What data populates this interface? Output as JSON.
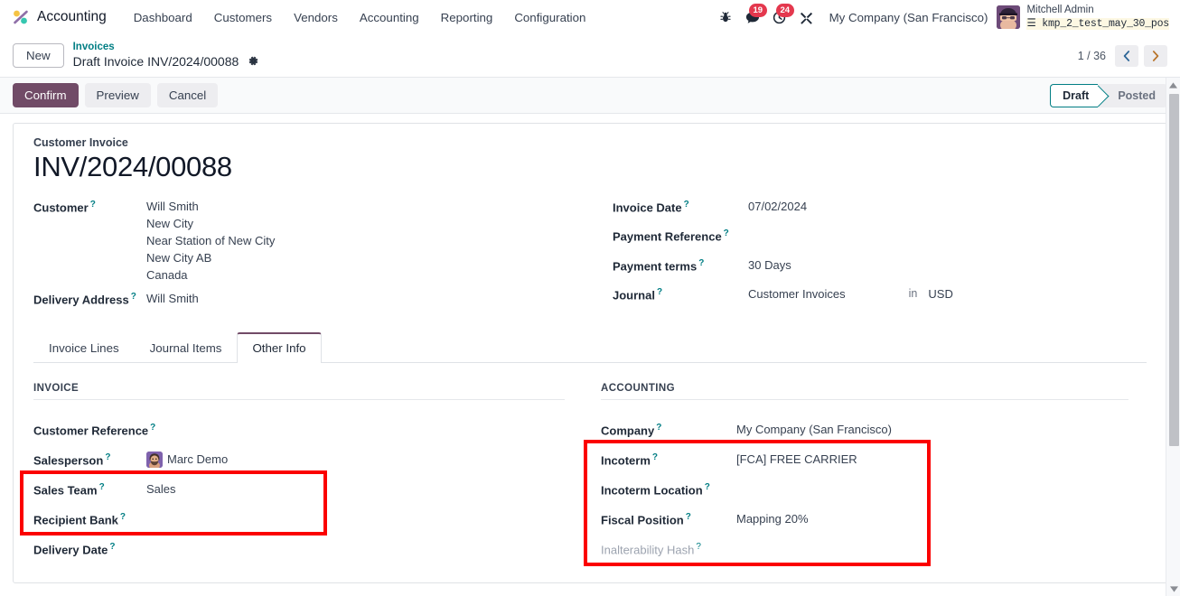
{
  "navbar": {
    "brand": "Accounting",
    "brand_logo_icon": "odoo-accounting-logo-icon",
    "menu": [
      "Dashboard",
      "Customers",
      "Vendors",
      "Accounting",
      "Reporting",
      "Configuration"
    ],
    "sys_icons": [
      {
        "name": "bug-icon",
        "badge": ""
      },
      {
        "name": "messages-icon",
        "badge": "19"
      },
      {
        "name": "activities-clock-icon",
        "badge": "24"
      },
      {
        "name": "tools-wrench-icon",
        "badge": ""
      }
    ],
    "company": "My Company (San Francisco)",
    "user_name": "Mitchell Admin",
    "user_db": "kmp_2_test_may_30_pos",
    "user_db_icon": "database-icon"
  },
  "breadcrumb": {
    "new_button": "New",
    "parent": "Invoices",
    "current": "Draft Invoice INV/2024/00088",
    "gear_icon": "gear-icon",
    "pager_count": "1 / 36",
    "prev_icon": "chevron-left-icon",
    "next_icon": "chevron-right-icon"
  },
  "actions": {
    "confirm": "Confirm",
    "preview": "Preview",
    "cancel": "Cancel",
    "status": [
      {
        "label": "Draft",
        "active": true
      },
      {
        "label": "Posted",
        "active": false
      }
    ]
  },
  "sheet": {
    "doc_type": "Customer Invoice",
    "doc_title": "INV/2024/00088",
    "left_fields": {
      "customer_label": "Customer",
      "customer_lines": [
        "Will Smith",
        "New City",
        "Near Station of New City",
        "New City AB",
        "Canada"
      ],
      "delivery_address_label": "Delivery Address",
      "delivery_address_value": "Will Smith"
    },
    "right_fields": [
      {
        "label": "Invoice Date",
        "value": "07/02/2024"
      },
      {
        "label": "Payment Reference",
        "value": ""
      },
      {
        "label": "Payment terms",
        "value": "30 Days"
      },
      {
        "label": "Journal",
        "value": "Customer Invoices"
      }
    ],
    "currency_in": "in",
    "currency": "USD"
  },
  "tabs": [
    {
      "label": "Invoice Lines",
      "active": false
    },
    {
      "label": "Journal Items",
      "active": false
    },
    {
      "label": "Other Info",
      "active": true
    }
  ],
  "other_info": {
    "invoice_section_title": "INVOICE",
    "invoice_fields": [
      {
        "label": "Customer Reference",
        "value": "",
        "avatar": false,
        "muted": false
      },
      {
        "label": "Salesperson",
        "value": "Marc Demo",
        "avatar": true,
        "muted": false
      },
      {
        "label": "Sales Team",
        "value": "Sales",
        "avatar": false,
        "muted": false
      },
      {
        "label": "Recipient Bank",
        "value": "",
        "avatar": false,
        "muted": false
      },
      {
        "label": "Delivery Date",
        "value": "",
        "avatar": false,
        "muted": false
      }
    ],
    "accounting_section_title": "ACCOUNTING",
    "accounting_fields": [
      {
        "label": "Company",
        "value": "My Company (San Francisco)",
        "muted": false
      },
      {
        "label": "Incoterm",
        "value": "[FCA] FREE CARRIER",
        "muted": false
      },
      {
        "label": "Incoterm Location",
        "value": "",
        "muted": false
      },
      {
        "label": "Fiscal Position",
        "value": "Mapping 20%",
        "muted": false
      },
      {
        "label": "Inalterability Hash",
        "value": "",
        "muted": true
      }
    ]
  },
  "colors": {
    "brand_purple": "#714b67",
    "teal": "#017e84",
    "badge_red": "#e4384e",
    "annotation_red": "#fb0000"
  }
}
